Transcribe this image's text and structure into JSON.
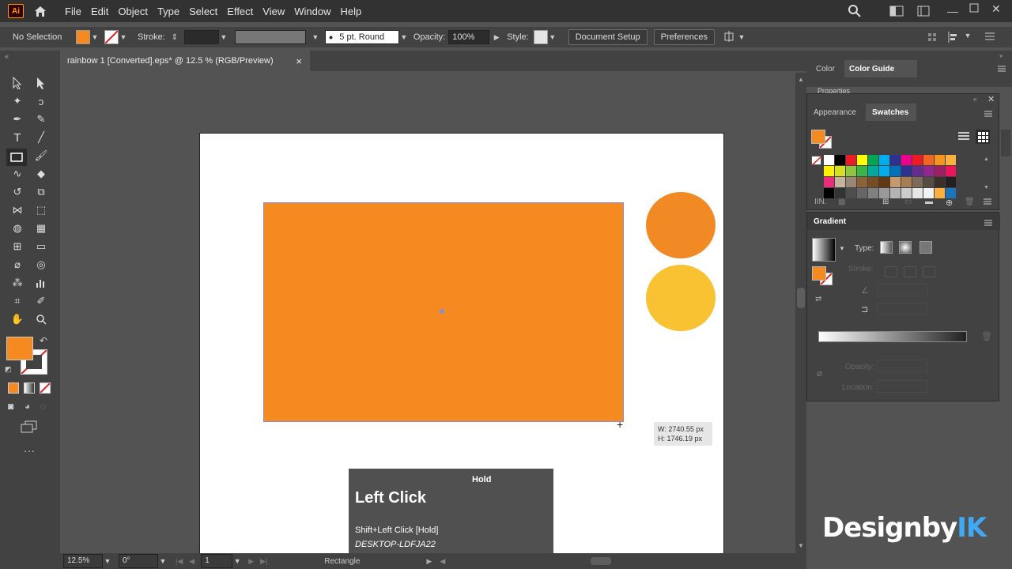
{
  "app": {
    "logo": "Ai"
  },
  "menu": [
    "File",
    "Edit",
    "Object",
    "Type",
    "Select",
    "Effect",
    "View",
    "Window",
    "Help"
  ],
  "control": {
    "selection": "No Selection",
    "stroke_label": "Stroke:",
    "brush": "5 pt. Round",
    "opacity_label": "Opacity:",
    "opacity_value": "100%",
    "style_label": "Style:",
    "doc_setup": "Document Setup",
    "preferences": "Preferences"
  },
  "document": {
    "tab_title": "rainbow 1 [Converted].eps* @ 12.5 % (RGB/Preview)",
    "close": "×"
  },
  "colors": {
    "fill": "#f48a20",
    "rect": "#f48a20",
    "circle1": "#f18a24",
    "circle2": "#f8c232"
  },
  "dims": {
    "w": "W: 2740.55 px",
    "h": "H: 1746.19 px"
  },
  "hint": {
    "hold": "Hold",
    "title": "Left Click",
    "line1": "Shift+Left Click [Hold]",
    "line2": "DESKTOP-LDFJA22"
  },
  "status": {
    "zoom": "12.5%",
    "rotate": "0°",
    "artboard": "1",
    "tool": "Rectangle"
  },
  "panels": {
    "color_tab": "Color",
    "color_guide_tab": "Color Guide",
    "properties_tab": "Properties",
    "appearance_tab": "Appearance",
    "swatches_tab": "Swatches",
    "gradient_title": "Gradient",
    "type_label": "Type:",
    "stroke_label": "Stroke:",
    "opacity_label": "Opacity:",
    "location_label": "Location:"
  },
  "swatches": [
    "#ffffff",
    "#000000",
    "#ed1c24",
    "#ffff00",
    "#00a651",
    "#00aeef",
    "#2e3192",
    "#ec008c",
    "#ed1c24",
    "#f26522",
    "#f7941d",
    "#fbb040",
    "#fff200",
    "#d7df23",
    "#8dc63f",
    "#39b54a",
    "#00a99d",
    "#00aeef",
    "#0072bc",
    "#2e3192",
    "#662d91",
    "#92278f",
    "#9e1f63",
    "#ed145b",
    "#ee2a7b",
    "#c2b59b",
    "#998675",
    "#8c6239",
    "#754c24",
    "#603913",
    "#c49a6c",
    "#a67c52",
    "#7f6b5c",
    "#564c42",
    "#3a302a",
    "#231f20",
    "#000000",
    "#333333",
    "#4d4d4d",
    "#666666",
    "#808080",
    "#999999",
    "#b3b3b3",
    "#cccccc",
    "#e6e6e6",
    "#f2f2f2",
    "#fbb040",
    "#1c75bc"
  ],
  "watermark": {
    "a": "Designby",
    "b": "IK",
    "b_color": "#3fa9f5"
  }
}
